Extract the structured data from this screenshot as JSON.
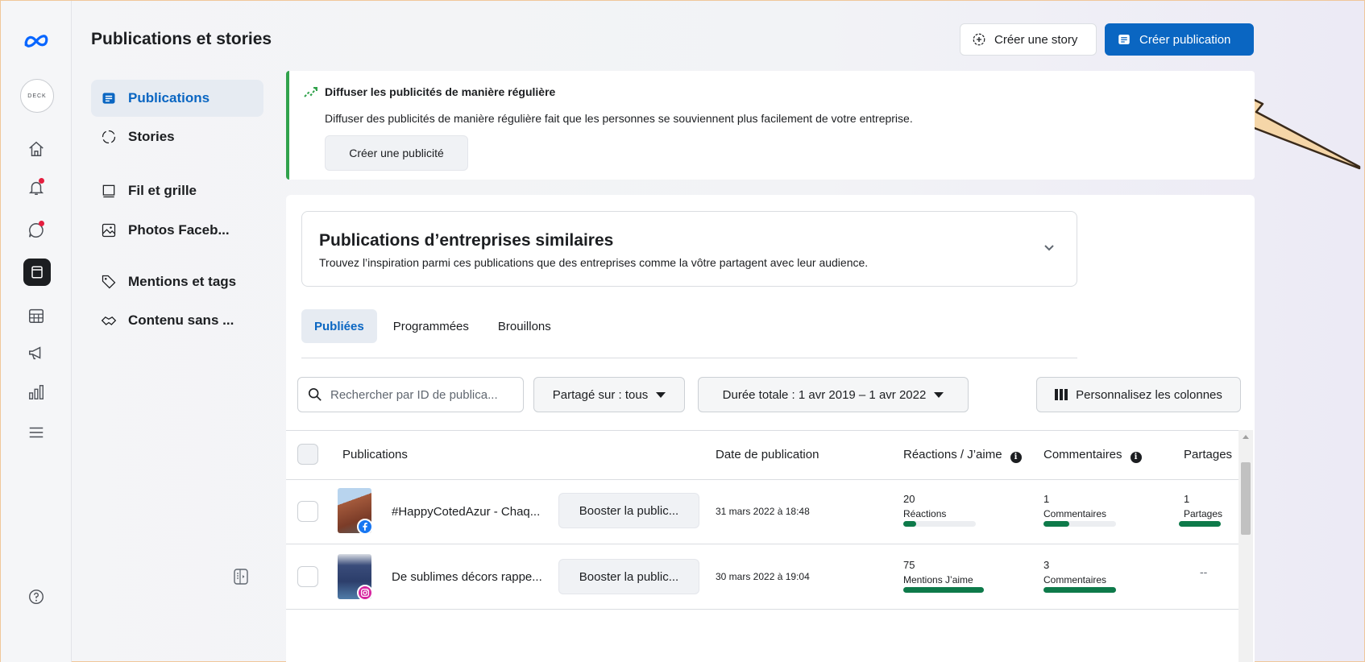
{
  "header": {
    "title": "Publications et stories",
    "create_story": "Créer une story",
    "create_post": "Créer publication"
  },
  "rail": {
    "avatar_text": "DECK",
    "icons": [
      "meta-logo-icon",
      "home-icon",
      "bell-icon",
      "chat-icon",
      "posts-icon",
      "calendar-icon",
      "megaphone-icon",
      "insights-icon",
      "menu-icon",
      "help-icon"
    ]
  },
  "nav": {
    "items": [
      {
        "label": "Publications",
        "icon": "posts-icon",
        "active": true
      },
      {
        "label": "Stories",
        "icon": "stories-icon"
      },
      {
        "label": "Fil et grille",
        "icon": "feed-grid-icon"
      },
      {
        "label": "Photos Faceb...",
        "icon": "photos-icon"
      },
      {
        "label": "Mentions et tags",
        "icon": "tag-icon"
      },
      {
        "label": "Contenu sans ...",
        "icon": "handshake-icon"
      }
    ]
  },
  "banner": {
    "title": "Diffuser les publicités de manière régulière",
    "text": "Diffuser des publicités de manière régulière fait que les personnes se souviennent plus facilement de votre entreprise.",
    "button": "Créer une publicité"
  },
  "similar": {
    "title": "Publications d’entreprises similaires",
    "subtitle": "Trouvez l’inspiration parmi ces publications que des entreprises comme la vôtre partagent avec leur audience."
  },
  "tabs": [
    {
      "label": "Publiées",
      "active": true
    },
    {
      "label": "Programmées"
    },
    {
      "label": "Brouillons"
    }
  ],
  "filters": {
    "search_placeholder": "Rechercher par ID de publica...",
    "shared_on": "Partagé sur : tous",
    "duration": "Durée totale : 1 avr 2019 – 1 avr 2022",
    "columns": "Personnalisez les colonnes"
  },
  "table": {
    "headers": {
      "posts": "Publications",
      "date": "Date de publication",
      "reactions": "Réactions / J’aime",
      "comments": "Commentaires",
      "shares": "Partages"
    },
    "rows": [
      {
        "text": "#HappyCotedAzur - Chaq...",
        "platform": "facebook",
        "boost": "Booster la public...",
        "date": "31 mars 2022 à 18:48",
        "reactions": {
          "value": "20",
          "label": "Réactions",
          "fill": 0.18
        },
        "comments": {
          "value": "1",
          "label": "Commentaires",
          "fill": 0.35
        },
        "shares": {
          "value": "1",
          "label": "Partages",
          "fill": 1.0
        }
      },
      {
        "text": "De sublimes décors rappe...",
        "platform": "instagram",
        "boost": "Booster la public...",
        "date": "30 mars 2022 à 19:04",
        "reactions": {
          "value": "75",
          "label": "Mentions J’aime",
          "fill": 1.0
        },
        "comments": {
          "value": "3",
          "label": "Commentaires",
          "fill": 1.0
        },
        "shares": {
          "value": "--"
        }
      }
    ]
  },
  "colors": {
    "accent": "#0a66c2",
    "success_bar": "#0e7a4a",
    "banner_border": "#31a24c",
    "annotation_arrow": "#f5d6a8"
  }
}
